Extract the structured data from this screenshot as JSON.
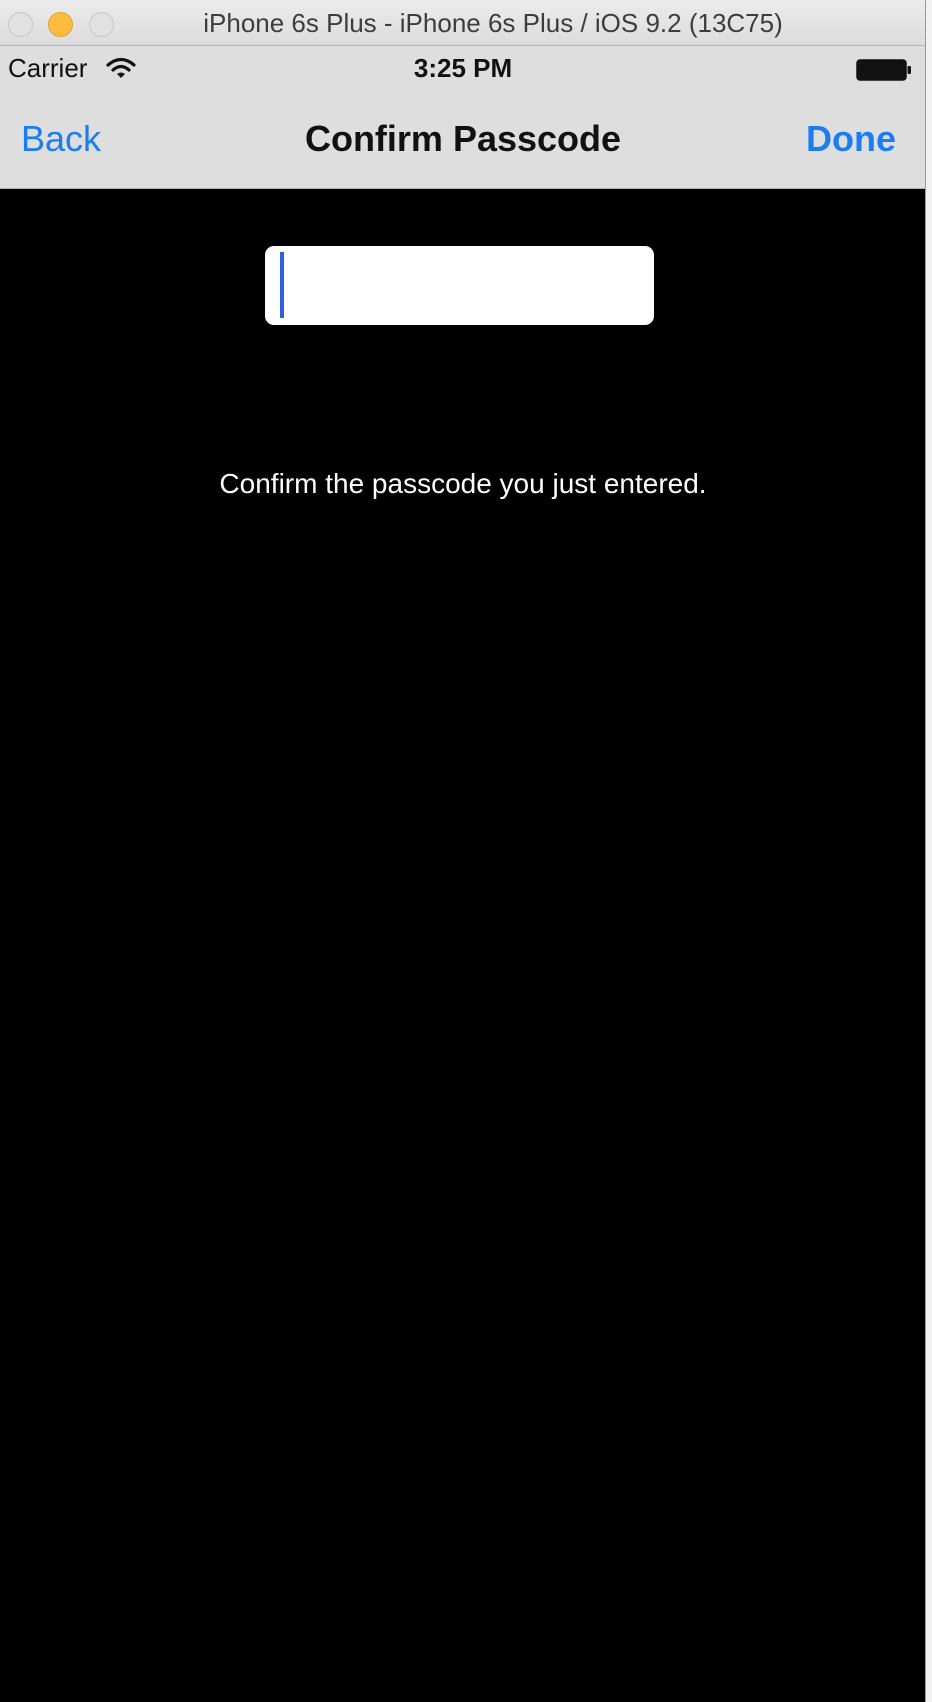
{
  "window": {
    "title": "iPhone 6s Plus - iPhone 6s Plus / iOS 9.2 (13C75)"
  },
  "status_bar": {
    "carrier": "Carrier",
    "time": "3:25 PM",
    "icons": [
      "wifi-icon",
      "battery-icon"
    ]
  },
  "nav_bar": {
    "back_label": "Back",
    "title": "Confirm Passcode",
    "done_label": "Done"
  },
  "passcode": {
    "value": "",
    "instructions": "Confirm the passcode you just entered."
  },
  "colors": {
    "accent": "#1a7ef2",
    "bar_background": "#dedede",
    "content_background": "#000000",
    "caret": "#2e62d4"
  }
}
